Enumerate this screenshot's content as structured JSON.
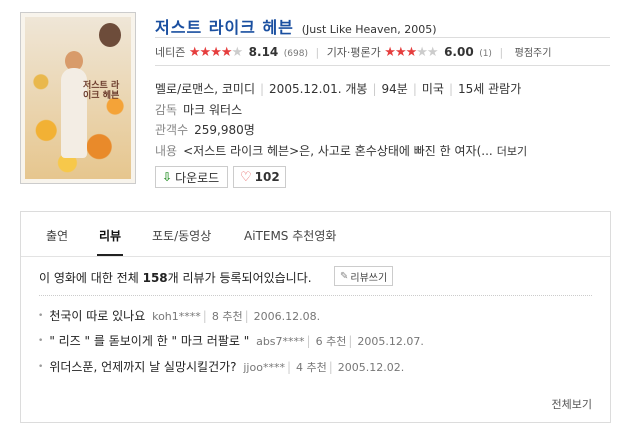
{
  "movie": {
    "title": "저스트 라이크 헤븐",
    "original": "(Just Like Heaven, 2005)",
    "poster_text": "저스트 라이크 헤븐"
  },
  "ratings": {
    "netizen_label": "네티즌",
    "netizen_stars": 4,
    "netizen_score": "8.14",
    "netizen_count": "(698)",
    "critic_label": "기자·평론가",
    "critic_stars": 3,
    "critic_score": "6.00",
    "critic_count": "(1)",
    "critic_link": "평점주기"
  },
  "info": {
    "genre": "멜로/로맨스, 코미디",
    "release": "2005.12.01. 개봉",
    "runtime": "94분",
    "country": "미국",
    "rating": "15세 관람가",
    "director_label": "감독",
    "director": "마크 워터스",
    "audience_label": "관객수",
    "audience": "259,980명",
    "summary_label": "내용",
    "summary": "<저스트 라이크 헤븐>은, 사고로 혼수상태에 빠진 한 여자(...",
    "more": "더보기"
  },
  "buttons": {
    "download": "다운로드",
    "likes": "102"
  },
  "tabs": [
    "출연",
    "리뷰",
    "포토/동영상",
    "AiTEMS 추천영화"
  ],
  "reviews": {
    "total_prefix": "이 영화에 대한 전체 ",
    "total_count": "158",
    "total_suffix": "개 리뷰가 등록되어있습니다.",
    "write": "리뷰쓰기",
    "items": [
      {
        "title": "천국이 따로 있나요",
        "user": "koh1****",
        "recommend": "8 추천",
        "date": "2006.12.08."
      },
      {
        "title": "\" 리즈 \" 를 돋보이게 한 \" 마크 러팔로 \"",
        "user": "abs7****",
        "recommend": "6 추천",
        "date": "2005.12.07."
      },
      {
        "title": "위더스푼, 언제까지 날 실망시킬건가?",
        "user": "jjoo****",
        "recommend": "4 추천",
        "date": "2005.12.02."
      }
    ],
    "view_all": "전체보기"
  },
  "colors": {
    "title": "#1a4fa0",
    "star": "#e53e3e",
    "download_icon": "#3a9a3a"
  }
}
